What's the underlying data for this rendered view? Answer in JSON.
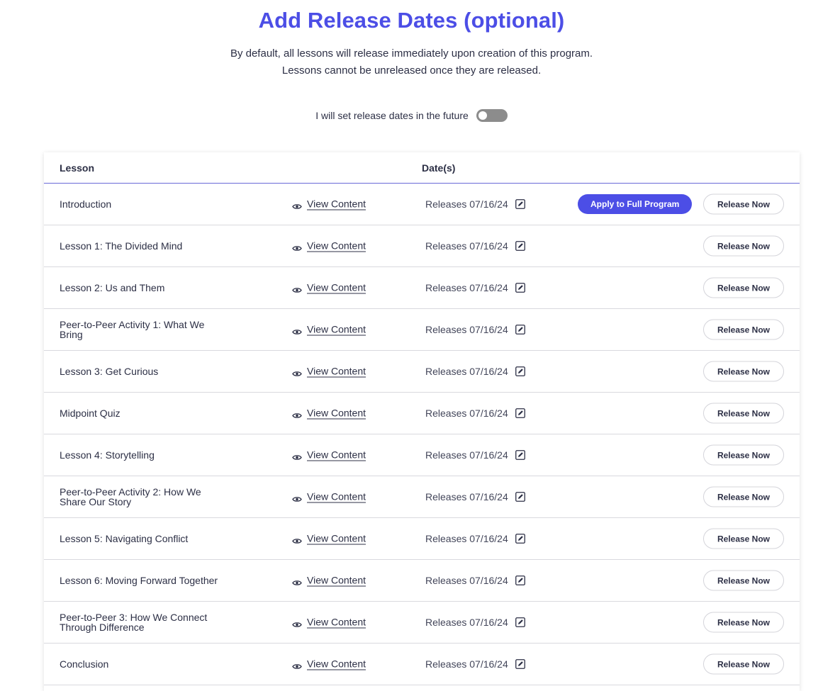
{
  "header": {
    "title": "Add Release Dates (optional)",
    "subtitle_line1": "By default, all lessons will release immediately upon creation of this program.",
    "subtitle_line2": "Lessons cannot be unreleased once they are released."
  },
  "toggle": {
    "label": "I will set release dates in the future",
    "state": "off"
  },
  "table": {
    "columns": {
      "lesson": "Lesson",
      "dates": "Date(s)"
    },
    "view_label": "View Content",
    "apply_label": "Apply to Full Program",
    "release_label": "Release Now",
    "rows": [
      {
        "name": "Introduction",
        "release": "Releases 07/16/24"
      },
      {
        "name": "Lesson 1: The Divided Mind",
        "release": "Releases 07/16/24"
      },
      {
        "name": "Lesson 2: Us and Them",
        "release": "Releases 07/16/24"
      },
      {
        "name": "Peer-to-Peer Activity 1: What We Bring",
        "release": "Releases 07/16/24"
      },
      {
        "name": "Lesson 3: Get Curious",
        "release": "Releases 07/16/24"
      },
      {
        "name": "Midpoint Quiz",
        "release": "Releases 07/16/24"
      },
      {
        "name": "Lesson 4: Storytelling",
        "release": "Releases 07/16/24"
      },
      {
        "name": "Peer-to-Peer Activity 2: How We Share Our Story",
        "release": "Releases 07/16/24"
      },
      {
        "name": "Lesson 5: Navigating Conflict",
        "release": "Releases 07/16/24"
      },
      {
        "name": "Lesson 6: Moving Forward Together",
        "release": "Releases 07/16/24"
      },
      {
        "name": "Peer-to-Peer 3: How We Connect Through Difference",
        "release": "Releases 07/16/24"
      },
      {
        "name": "Conclusion",
        "release": "Releases 07/16/24"
      }
    ]
  },
  "colors": {
    "accent": "#4c4ee6",
    "text": "#2c2f45",
    "toggle_off": "#8c8c8c"
  },
  "icons": {
    "view": "eye-icon",
    "edit": "edit-icon"
  }
}
